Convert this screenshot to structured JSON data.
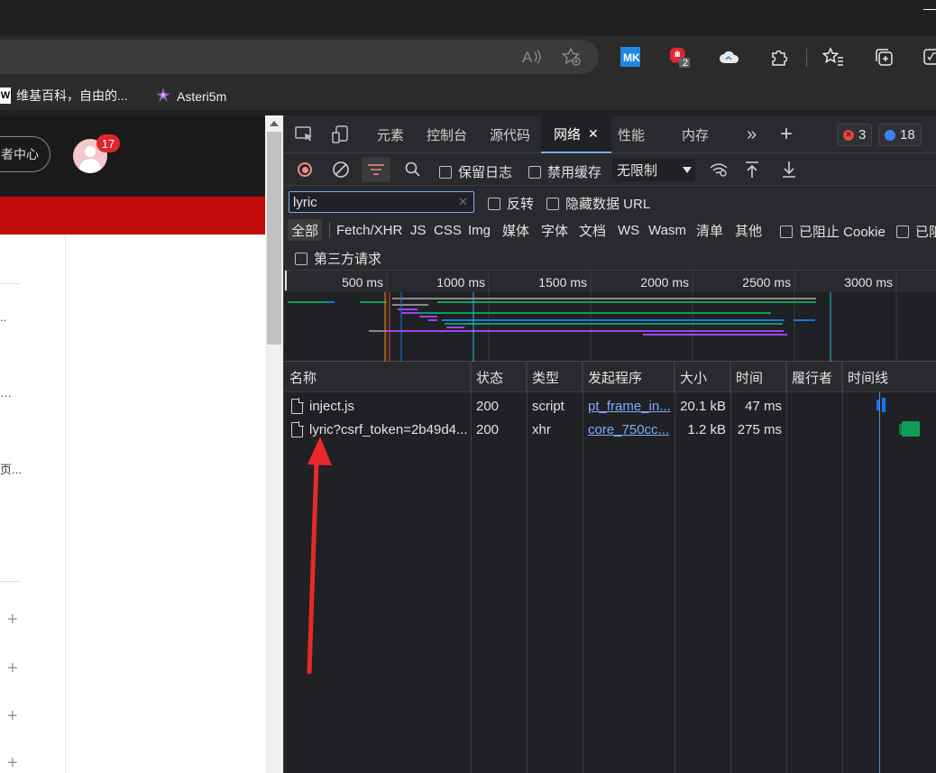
{
  "browser": {
    "read_aloud_icon": "A»",
    "bookmarks": [
      {
        "label": "维基百科，自由的...",
        "icon": "W"
      },
      {
        "label": "Asteri5m",
        "icon": "star-logo"
      }
    ],
    "extension_badge": "2"
  },
  "webpage": {
    "creator_center_label": "者中心",
    "avatar_badge": "17",
    "truncated_items": [
      "..",
      "…",
      "页..."
    ],
    "plus_icon": "+"
  },
  "devtools": {
    "tabs": [
      {
        "label": "元素"
      },
      {
        "label": "控制台"
      },
      {
        "label": "源代码"
      },
      {
        "label": "网络",
        "active": true,
        "close": "✕"
      },
      {
        "label": "性能"
      },
      {
        "label": "内存"
      }
    ],
    "more_tabs": "»",
    "add_tab": "+",
    "error_count": "3",
    "message_count": "18",
    "network": {
      "preserve_log": "保留日志",
      "disable_cache": "禁用缓存",
      "throttling": "无限制",
      "filter_value": "lyric",
      "filter_clear": "✕",
      "invert": "反转",
      "hide_data_urls": "隐藏数据 URL",
      "type_filters": [
        "全部",
        "Fetch/XHR",
        "JS",
        "CSS",
        "Img",
        "媒体",
        "字体",
        "文档",
        "WS",
        "Wasm",
        "清单",
        "其他"
      ],
      "blocked_cookies": "已阻止 Cookie",
      "blocked_requests": "已阻",
      "third_party": "第三方请求",
      "timeline_ticks": [
        "500 ms",
        "1000 ms",
        "1500 ms",
        "2000 ms",
        "2500 ms",
        "3000 ms"
      ],
      "columns": [
        "名称",
        "状态",
        "类型",
        "发起程序",
        "大小",
        "时间",
        "履行者",
        "时间线"
      ],
      "rows": [
        {
          "name": "inject.js",
          "status": "200",
          "type": "script",
          "initiator": "pt_frame_in...",
          "size": "20.1 kB",
          "time": "47 ms",
          "fulfilled_by": "",
          "bar_color": "#1a73e8"
        },
        {
          "name": "lyric?csrf_token=2b49d4...",
          "status": "200",
          "type": "xhr",
          "initiator": "core_750cc...",
          "size": "1.2 kB",
          "time": "275 ms",
          "fulfilled_by": "",
          "bar_color": "#0f9d58"
        }
      ]
    }
  },
  "annotation": {
    "arrow_color": "#e8282c"
  }
}
